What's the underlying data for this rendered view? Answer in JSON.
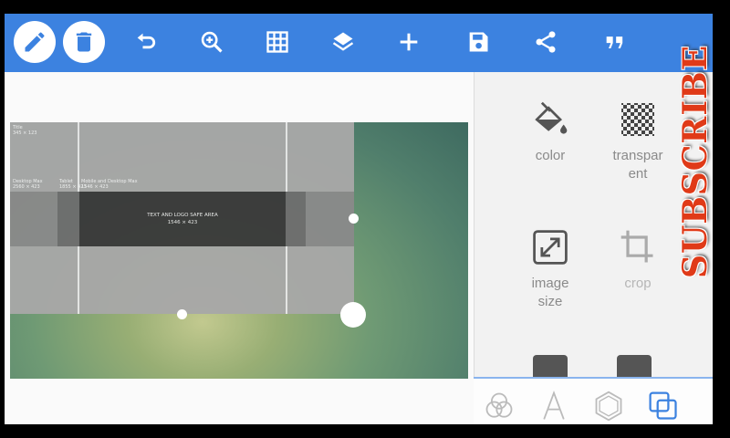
{
  "toolbar": {
    "color": "#3c82e0",
    "icons": [
      "pencil-icon",
      "trash-icon",
      "undo-icon",
      "zoom-in-icon",
      "grid-icon",
      "layers-icon",
      "add-icon",
      "save-icon",
      "share-icon",
      "quote-icon"
    ]
  },
  "canvas": {
    "template_texts": {
      "top_left_1": "Title",
      "top_left_2": "345 × 123",
      "col1_title": "Desktop Max",
      "col1_sub": "2560 × 423",
      "col2_title": "Tablet",
      "col2_sub": "1855 × 423",
      "col3_title": "Mobile and Desktop Max",
      "col3_sub": "1546 × 423",
      "center_line1": "TEXT AND LOGO SAFE AREA",
      "center_line2": "1546 × 423"
    }
  },
  "panel": {
    "tools": [
      {
        "name": "color",
        "label": "color",
        "icon": "paint-bucket-icon",
        "enabled": true
      },
      {
        "name": "transparent",
        "label": "transpar\nent",
        "icon": "checkerboard-icon",
        "enabled": true
      },
      {
        "name": "image-size",
        "label": "image\nsize",
        "icon": "resize-icon",
        "enabled": true
      },
      {
        "name": "crop",
        "label": "crop",
        "icon": "crop-icon",
        "enabled": false
      }
    ],
    "bottom_icons": [
      "blend-icon",
      "text-icon",
      "shape-icon",
      "layer-icon"
    ]
  },
  "overlay": {
    "subscribe_text": "SUBSCRIBE",
    "color": "#e03a18"
  }
}
